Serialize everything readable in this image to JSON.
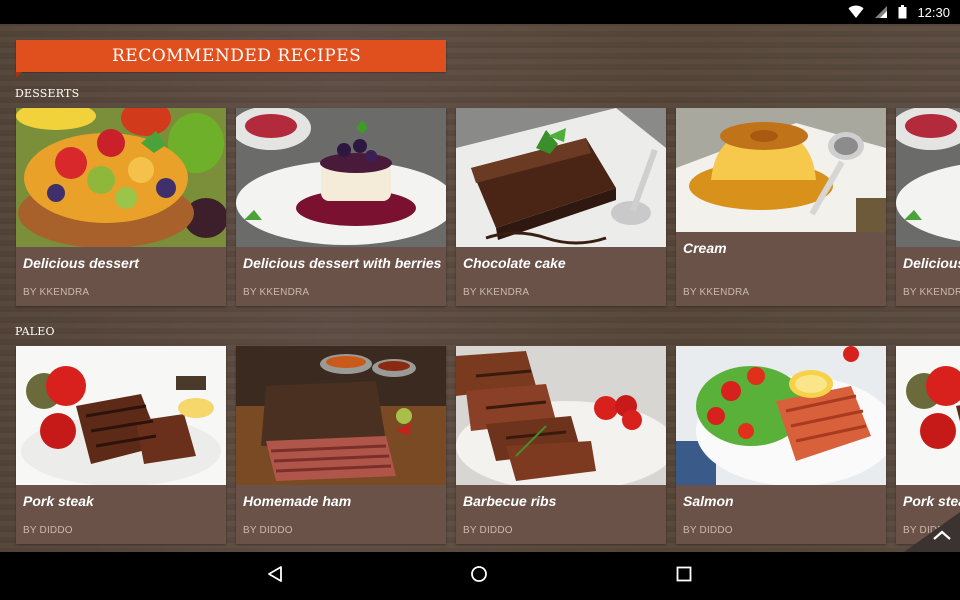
{
  "status_bar": {
    "time": "12:30",
    "icons": [
      "wifi-icon",
      "signal-icon",
      "battery-icon"
    ]
  },
  "banner": {
    "title": "RECOMMENDED RECIPES"
  },
  "sections": [
    {
      "label": "DESSERTS",
      "cards": [
        {
          "title": "Delicious dessert",
          "author": "BY KKENDRA"
        },
        {
          "title": "Delicious dessert with berries",
          "author": "BY KKENDRA"
        },
        {
          "title": "Chocolate cake",
          "author": "BY KKENDRA"
        },
        {
          "title": "Cream",
          "author": "BY KKENDRA"
        },
        {
          "title": "Delicious dessert",
          "author": "BY KKENDRA"
        }
      ]
    },
    {
      "label": "PALEO",
      "cards": [
        {
          "title": "Pork steak",
          "author": "BY DIDDO"
        },
        {
          "title": "Homemade ham",
          "author": "BY DIDDO"
        },
        {
          "title": "Barbecue ribs",
          "author": "BY DIDDO"
        },
        {
          "title": "Salmon",
          "author": "BY DIDDO"
        },
        {
          "title": "Pork steak",
          "author": "BY DIDDO"
        }
      ]
    }
  ],
  "nav_bar": {
    "icons": [
      "back-icon",
      "home-icon",
      "recents-icon"
    ]
  },
  "colors": {
    "accent": "#e0501e",
    "card": "#6a5248",
    "wood": "#5a4a40"
  }
}
